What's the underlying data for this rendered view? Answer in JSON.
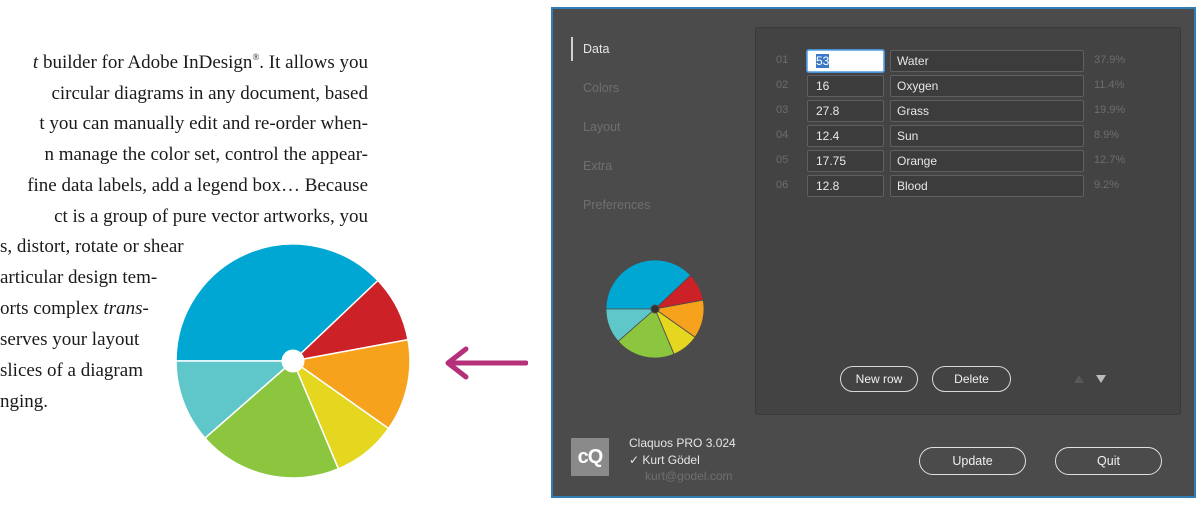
{
  "document": {
    "lines": [
      {
        "pre": "",
        "em": "t",
        "post": " builder for Adobe InDesign",
        "sup": "®",
        "tail": ". It allows you"
      },
      {
        "pre": "circular diagrams in any document, based",
        "em": "",
        "post": "",
        "sup": "",
        "tail": ""
      },
      {
        "pre": "t you can manually edit and re-order when-",
        "em": "",
        "post": "",
        "sup": "",
        "tail": ""
      },
      {
        "pre": "n manage the color set, control the appear-",
        "em": "",
        "post": "",
        "sup": "",
        "tail": ""
      },
      {
        "pre": "fine data labels, add a legend box… Because",
        "em": "",
        "post": "",
        "sup": "",
        "tail": ""
      },
      {
        "pre": "ct is a group of pure vector artworks, you",
        "em": "",
        "post": "",
        "sup": "",
        "tail": ""
      },
      {
        "pre": "s, distort, rotate or shear",
        "em": "",
        "post": "",
        "sup": "",
        "tail": ""
      },
      {
        "pre": "articular design tem-",
        "em": "",
        "post": "",
        "sup": "",
        "tail": ""
      },
      {
        "pre": "orts complex ",
        "em": "trans-",
        "post": "",
        "sup": "",
        "tail": ""
      },
      {
        "pre": "serves your layout",
        "em": "",
        "post": "",
        "sup": "",
        "tail": ""
      },
      {
        "pre": "slices of a diagram",
        "em": "",
        "post": "",
        "sup": "",
        "tail": ""
      },
      {
        "pre": "nging.",
        "em": "",
        "post": "",
        "sup": "",
        "tail": ""
      }
    ]
  },
  "colors": {
    "arrow": "#b5307a",
    "slices": [
      "#00a7d3",
      "#cc2127",
      "#f7a21c",
      "#e5d61f",
      "#8cc63f",
      "#5fc7c9"
    ]
  },
  "dialog": {
    "sidebar": [
      {
        "label": "Data",
        "active": true
      },
      {
        "label": "Colors",
        "active": false
      },
      {
        "label": "Layout",
        "active": false
      },
      {
        "label": "Extra",
        "active": false
      },
      {
        "label": "Preferences",
        "active": false
      }
    ],
    "rows": [
      {
        "num": "01",
        "value": "53",
        "name": "Water",
        "pct": "37.9%"
      },
      {
        "num": "02",
        "value": "16",
        "name": "Oxygen",
        "pct": "11.4%"
      },
      {
        "num": "03",
        "value": "27.8",
        "name": "Grass",
        "pct": "19.9%"
      },
      {
        "num": "04",
        "value": "12.4",
        "name": "Sun",
        "pct": "8.9%"
      },
      {
        "num": "05",
        "value": "17.75",
        "name": "Orange",
        "pct": "12.7%"
      },
      {
        "num": "06",
        "value": "12.8",
        "name": "Blood",
        "pct": "9.2%"
      }
    ],
    "buttons": {
      "new_row": "New row",
      "delete": "Delete",
      "update": "Update",
      "quit": "Quit"
    },
    "footer": {
      "logo": "cQ",
      "product": "Claquos PRO 3.024",
      "user": "✓ Kurt Gödel",
      "email": "kurt@godel.com"
    }
  },
  "pie": {
    "order": [
      "Water",
      "Blood",
      "Orange",
      "Sun",
      "Grass",
      "Oxygen"
    ],
    "values": [
      53,
      12.8,
      17.75,
      12.4,
      27.8,
      16
    ]
  }
}
